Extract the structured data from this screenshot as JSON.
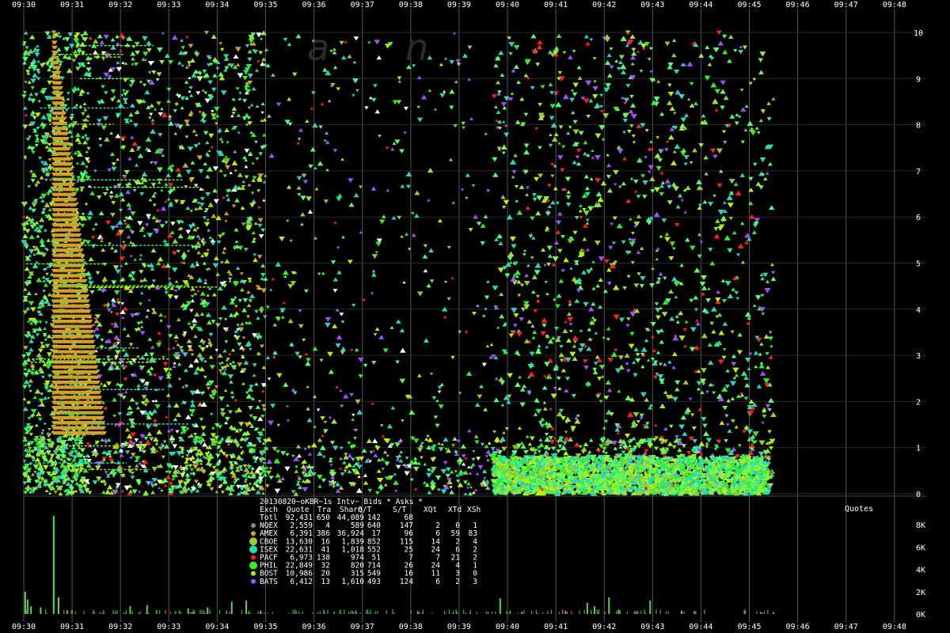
{
  "chart_data": {
    "type": "scatter",
    "title": "20130820~oKBR~1s Intv~ Bids * Asks *",
    "watermark": "a n",
    "x_ticks": [
      "09:30",
      "09:31",
      "09:32",
      "09:33",
      "09:34",
      "09:35",
      "09:36",
      "09:37",
      "09:38",
      "09:39",
      "09:40",
      "09:41",
      "09:42",
      "09:43",
      "09:44",
      "09:45",
      "09:46",
      "09:47",
      "09:48"
    ],
    "price_panel": {
      "y_ticks": [
        "0",
        "1",
        "2",
        "3",
        "4",
        "5",
        "6",
        "7",
        "8",
        "9",
        "10"
      ],
      "ylim": [
        0,
        10
      ]
    },
    "volume_panel": {
      "label": "Quotes",
      "y_ticks": [
        "0K",
        "2K",
        "4K",
        "6K",
        "8K"
      ],
      "ylim": [
        0,
        8500
      ],
      "bars": [
        {
          "t": 0.03,
          "v": 2000
        },
        {
          "t": 0.08,
          "v": 1300
        },
        {
          "t": 0.15,
          "v": 700
        },
        {
          "t": 0.35,
          "v": 600
        },
        {
          "t": 0.62,
          "v": 8800
        },
        {
          "t": 0.72,
          "v": 1500
        },
        {
          "t": 0.9,
          "v": 300
        },
        {
          "t": 2.2,
          "v": 700
        },
        {
          "t": 2.55,
          "v": 800
        },
        {
          "t": 3.4,
          "v": 500
        },
        {
          "t": 3.8,
          "v": 600
        },
        {
          "t": 4.3,
          "v": 1100
        },
        {
          "t": 4.6,
          "v": 1200
        },
        {
          "t": 4.9,
          "v": 300
        },
        {
          "t": 9.85,
          "v": 1400
        },
        {
          "t": 10.3,
          "v": 200
        },
        {
          "t": 11.2,
          "v": 300
        },
        {
          "t": 11.65,
          "v": 1000
        },
        {
          "t": 11.8,
          "v": 700
        },
        {
          "t": 12.1,
          "v": 1500
        },
        {
          "t": 12.3,
          "v": 400
        },
        {
          "t": 12.95,
          "v": 1200
        },
        {
          "t": 13.6,
          "v": 300
        },
        {
          "t": 14.9,
          "v": 200
        },
        {
          "t": 15.5,
          "v": 150
        }
      ]
    },
    "legend": {
      "title": "20130820~oKBR~1s Intv~ Bids * Asks *",
      "columns": [
        "Exch",
        "Quote",
        "Tra",
        "Share",
        "Q/T",
        "S/T",
        "XQt",
        "XTd",
        "XSh"
      ],
      "rows": [
        {
          "exch": "Totl",
          "quote": "92,431",
          "tra": "650",
          "share": "44,089",
          "qt": "142",
          "st": "68",
          "xqt": "",
          "xtd": "",
          "xsh": "",
          "color": ""
        },
        {
          "exch": "NQEX",
          "quote": "2,559",
          "tra": "4",
          "share": "589",
          "qt": "640",
          "st": "147",
          "xqt": "2",
          "xtd": "0",
          "xsh": "1",
          "color": "#8a8a8a"
        },
        {
          "exch": "AMEX",
          "quote": "6,391",
          "tra": "386",
          "share": "36,924",
          "qt": "17",
          "st": "96",
          "xqt": "6",
          "xtd": "59",
          "xsh": "83",
          "color": "#d4a02a"
        },
        {
          "exch": "CBOE",
          "quote": "13,630",
          "tra": "16",
          "share": "1,839",
          "qt": "852",
          "st": "115",
          "xqt": "14",
          "xtd": "2",
          "xsh": "4",
          "color": "#9acd32"
        },
        {
          "exch": "ISEX",
          "quote": "22,631",
          "tra": "41",
          "share": "1,018",
          "qt": "552",
          "st": "25",
          "xqt": "24",
          "xtd": "6",
          "xsh": "2",
          "color": "#20e0b0"
        },
        {
          "exch": "PACF",
          "quote": "6,973",
          "tra": "138",
          "share": "974",
          "qt": "51",
          "st": "7",
          "xqt": "7",
          "xtd": "21",
          "xsh": "2",
          "color": "#ff2020"
        },
        {
          "exch": "PHIL",
          "quote": "22,849",
          "tra": "32",
          "share": "820",
          "qt": "714",
          "st": "26",
          "xqt": "24",
          "xtd": "4",
          "xsh": "1",
          "color": "#30ee30"
        },
        {
          "exch": "BOST",
          "quote": "10,986",
          "tra": "20",
          "share": "315",
          "qt": "549",
          "st": "16",
          "xqt": "11",
          "xtd": "3",
          "xsh": "0",
          "color": "#c0f000"
        },
        {
          "exch": "BATS",
          "quote": "6,412",
          "tra": "13",
          "share": "1,610",
          "qt": "493",
          "st": "124",
          "xqt": "6",
          "xtd": "2",
          "xsh": "3",
          "color": "#a050ff"
        }
      ]
    }
  }
}
